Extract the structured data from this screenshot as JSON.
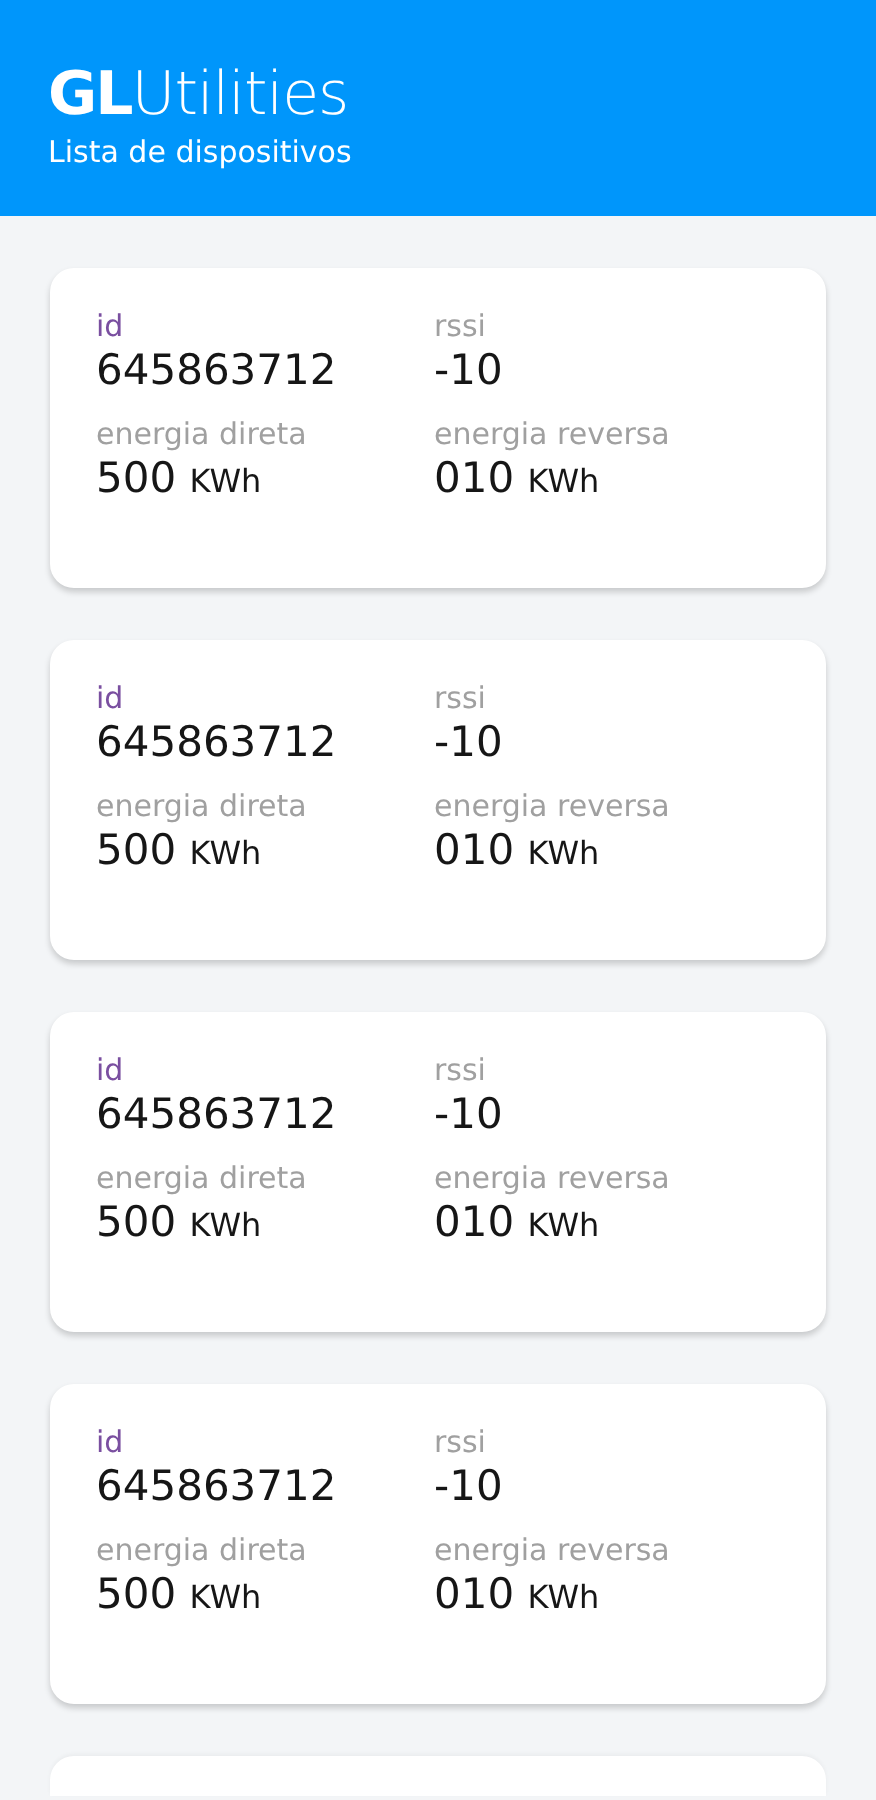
{
  "header": {
    "title": "**GL**Utilities",
    "subtitle": "Lista de dispositivos"
  },
  "devices": [
    {
      "fields": [
        {
          "kind": "id",
          "label": "id",
          "value": "645863712"
        },
        {
          "kind": "plain",
          "label": "rssi",
          "value": "-10"
        },
        {
          "kind": "plain",
          "label": "energia direta",
          "value": "500",
          "unit": "KWh"
        },
        {
          "kind": "plain",
          "label": "energia reversa",
          "value": "010",
          "unit": "KWh"
        }
      ]
    },
    {
      "fields": [
        {
          "kind": "id",
          "label": "id",
          "value": "645863712"
        },
        {
          "kind": "plain",
          "label": "rssi",
          "value": "-10"
        },
        {
          "kind": "plain",
          "label": "energia direta",
          "value": "500",
          "unit": "KWh"
        },
        {
          "kind": "plain",
          "label": "energia reversa",
          "value": "010",
          "unit": "KWh"
        }
      ]
    },
    {
      "fields": [
        {
          "kind": "id",
          "label": "id",
          "value": "645863712"
        },
        {
          "kind": "plain",
          "label": "rssi",
          "value": "-10"
        },
        {
          "kind": "plain",
          "label": "energia direta",
          "value": "500",
          "unit": "KWh"
        },
        {
          "kind": "plain",
          "label": "energia reversa",
          "value": "010",
          "unit": "KWh"
        }
      ]
    },
    {
      "fields": [
        {
          "kind": "id",
          "label": "id",
          "value": "645863712"
        },
        {
          "kind": "plain",
          "label": "rssi",
          "value": "-10"
        },
        {
          "kind": "plain",
          "label": "energia direta",
          "value": "500",
          "unit": "KWh"
        },
        {
          "kind": "plain",
          "label": "energia reversa",
          "value": "010",
          "unit": "KWh"
        }
      ]
    }
  ],
  "more_below": true
}
